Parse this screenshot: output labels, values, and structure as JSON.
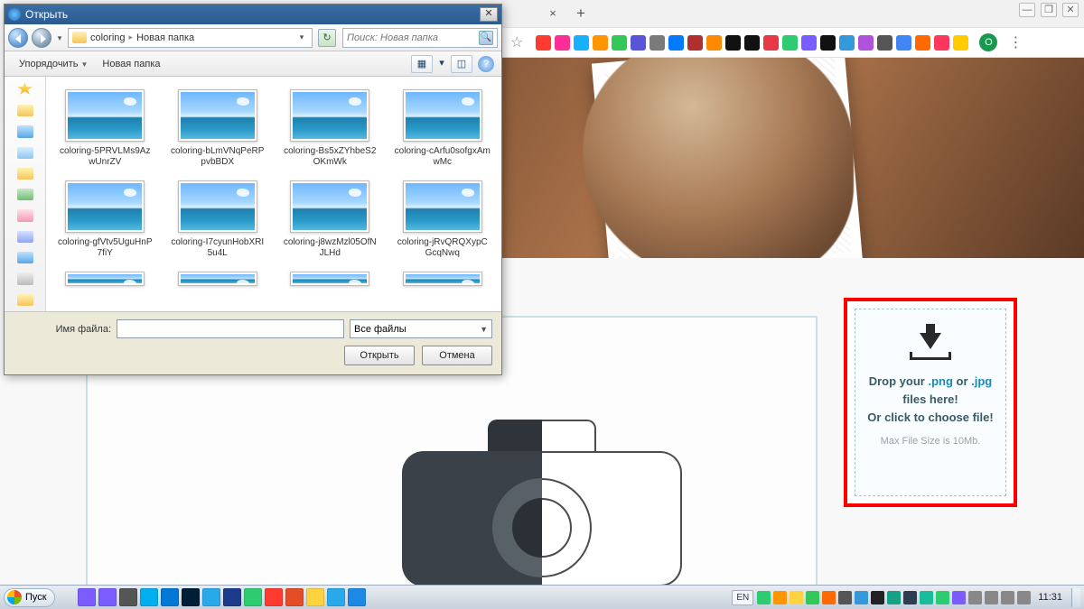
{
  "browser": {
    "close_x": "×",
    "newtab": "+",
    "win": {
      "min": "—",
      "max": "❐",
      "close": "✕"
    },
    "avatar_letter": "O",
    "ext_colors": [
      "#ff3b30",
      "#ff2d95",
      "#17b1ff",
      "#ff9500",
      "#34c759",
      "#5856d6",
      "#7a7a7a",
      "#007aff",
      "#b03030",
      "#ff8a00",
      "#111",
      "#111",
      "#e63946",
      "#2ecc71",
      "#7b5cff",
      "#111",
      "#3498db",
      "#af52de",
      "#555",
      "#4285f4",
      "#ff6b00",
      "#ff375f",
      "#ffcc00"
    ]
  },
  "drop": {
    "line1_pre": "Drop your ",
    "ext1": ".png",
    "or": " or ",
    "ext2": ".jpg",
    "line1_post": " files here!",
    "line2": "Or click to choose file!",
    "note": "Max File Size is 10Mb."
  },
  "dlg": {
    "title": "Открыть",
    "breadcrumb": {
      "seg1": "coloring",
      "seg2": "Новая папка"
    },
    "search_placeholder": "Поиск: Новая папка",
    "toolbar": {
      "organize": "Упорядочить",
      "newfolder": "Новая папка"
    },
    "filename_label": "Имя файла:",
    "filter": "Все файлы",
    "open_btn": "Открыть",
    "cancel_btn": "Отмена",
    "files": [
      "coloring-5PRVLMs9AzwUnrZV",
      "coloring-bLmVNqPeRPpvbBDX",
      "coloring-Bs5xZYhbeS2OKmWk",
      "coloring-cArfu0sofgxAmwMc",
      "coloring-gfVtv5UguHnP7fiY",
      "coloring-I7cyunHobXRI5u4L",
      "coloring-j8wzMzl05OfNJLHd",
      "coloring-jRvQRQXypCGcqNwq"
    ]
  },
  "taskbar": {
    "start": "Пуск",
    "lang": "EN",
    "time": "11:31",
    "app_colors": [
      "#7b5cff",
      "#7b5cff",
      "#555",
      "#00aff0",
      "#0078d7",
      "#001e36",
      "#29a9ea",
      "#1e3a8a",
      "#2ecc71",
      "#ff3b30",
      "#e44d26",
      "#ffd23f",
      "#29a9ea",
      "#1e88e5"
    ],
    "tray_colors": [
      "#2ecc71",
      "#ff9500",
      "#ffd23f",
      "#34c759",
      "#ff6b00",
      "#555",
      "#3498db",
      "#222",
      "#16a085",
      "#2c3e50",
      "#1abc9c",
      "#2ecc71",
      "#7b5cff",
      "#888",
      "#888",
      "#888",
      "#888"
    ]
  }
}
